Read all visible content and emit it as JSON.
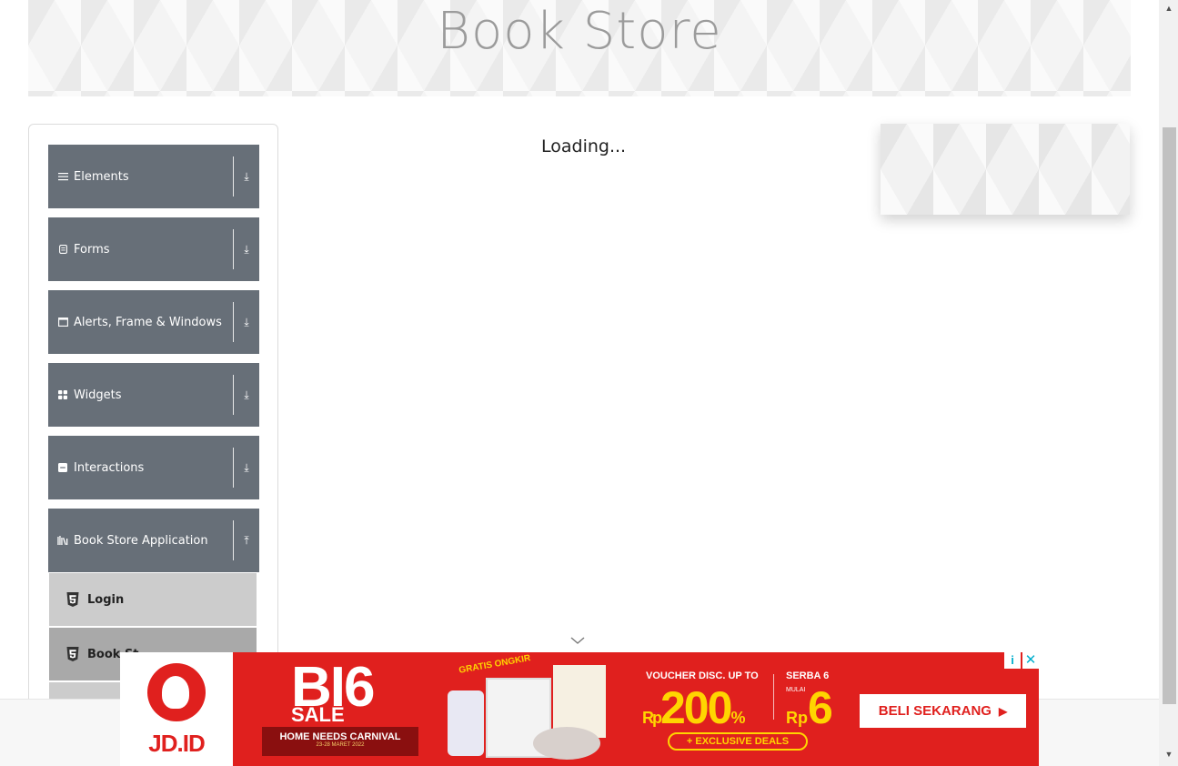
{
  "header": {
    "title": "Book Store"
  },
  "sidebar": {
    "groups": [
      {
        "label": "Elements",
        "icon": "menu-lines-icon",
        "arrow": "⤓"
      },
      {
        "label": "Forms",
        "icon": "form-doc-icon",
        "arrow": "⤓"
      },
      {
        "label": "Alerts, Frame & Windows",
        "icon": "window-icon",
        "arrow": "⤓"
      },
      {
        "label": "Widgets",
        "icon": "widgets-grid-icon",
        "arrow": "⤓"
      },
      {
        "label": "Interactions",
        "icon": "interactions-icon",
        "arrow": "⤓"
      },
      {
        "label": "Book Store Application",
        "icon": "books-icon",
        "arrow": "⤒"
      }
    ],
    "sub_items": [
      {
        "label": "Login",
        "icon": "html5-icon"
      },
      {
        "label": "Book St",
        "icon": "html5-icon"
      }
    ]
  },
  "main": {
    "status": "Loading..."
  },
  "ad": {
    "brand": "JD.ID",
    "headline": "BI6",
    "sale": "SALE",
    "carnival": "HOME NEEDS CARNIVAL",
    "carnival_date": "23-28 MARET 2022",
    "gratis": "GRATIS ONGKIR",
    "voucher": "VOUCHER DISC. UP TO",
    "voucher_amount": "200",
    "currency": "Rp",
    "percent": "%",
    "exclusive": "+ EXCLUSIVE DEALS",
    "serba": "SERBA 6",
    "mulai": "MULAI",
    "serba_amount": "6",
    "cta": "BELI SEKARANG",
    "cta_arrow": "▶",
    "info": "i",
    "close": "✕",
    "brand_color": "#e0201e",
    "accent_color": "#ffd500"
  },
  "colors": {
    "sidebar_group_bg": "#676f78",
    "sub_item_bg": "#cccccc",
    "sub_item_active_bg": "#a9a9a9"
  }
}
